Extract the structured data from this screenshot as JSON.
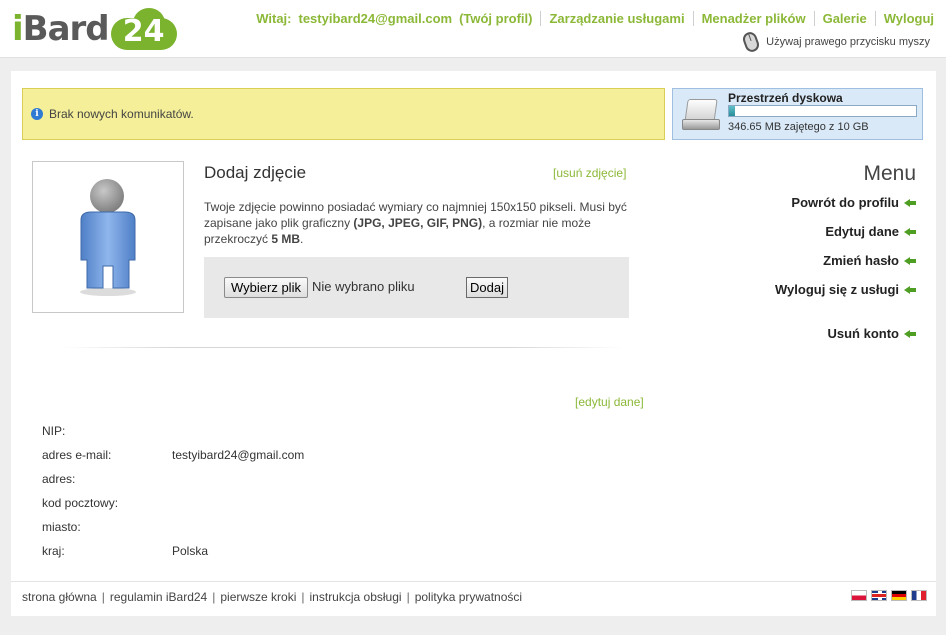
{
  "header": {
    "logo": {
      "i": "i",
      "bard": "Bard",
      "num": "24"
    },
    "greeting": "Witaj:",
    "user_email": "testyibard24@gmail.com",
    "profile_link": "(Twój profil)",
    "nav": [
      "Zarządzanie usługami",
      "Menadżer plików",
      "Galerie",
      "Wyloguj"
    ],
    "mouse_text": "Używaj prawego przycisku myszy"
  },
  "message": {
    "text": "Brak nowych komunikatów."
  },
  "disk": {
    "title": "Przestrzeń dyskowa",
    "usage_text": "346.65 MB zajętego z 10 GB",
    "used_fraction": 0.034
  },
  "photo": {
    "title": "Dodaj zdjęcie",
    "remove_link": "usuń zdjęcie",
    "desc_1": "Twoje zdjęcie powinno posiadać wymiary co najmniej 150x150 pikseli. Musi być zapisane jako plik graficzny ",
    "desc_formats": "(JPG, JPEG, GIF, PNG)",
    "desc_2": ", a rozmiar nie może przekroczyć ",
    "desc_size": "5 MB",
    "desc_3": ".",
    "choose_button": "Wybierz plik",
    "no_file": "Nie wybrano pliku",
    "add_button": "Dodaj"
  },
  "menu": {
    "title": "Menu",
    "items": [
      "Powrót do profilu",
      "Edytuj dane",
      "Zmień hasło",
      "Wyloguj się z usługi",
      "Usuń konto"
    ]
  },
  "details": {
    "edit_link": "edytuj dane",
    "rows": [
      {
        "label": "NIP:",
        "value": ""
      },
      {
        "label": "adres e-mail:",
        "value": "testyibard24@gmail.com"
      },
      {
        "label": "adres:",
        "value": ""
      },
      {
        "label": "kod pocztowy:",
        "value": ""
      },
      {
        "label": "miasto:",
        "value": ""
      },
      {
        "label": "kraj:",
        "value": "Polska"
      }
    ]
  },
  "footer": {
    "links": [
      "strona główna",
      "regulamin iBard24",
      "pierwsze kroki",
      "instrukcja obsługi",
      "polityka prywatności"
    ],
    "flags": [
      "pl-flag",
      "gb-flag",
      "de-flag",
      "fr-flag"
    ]
  }
}
